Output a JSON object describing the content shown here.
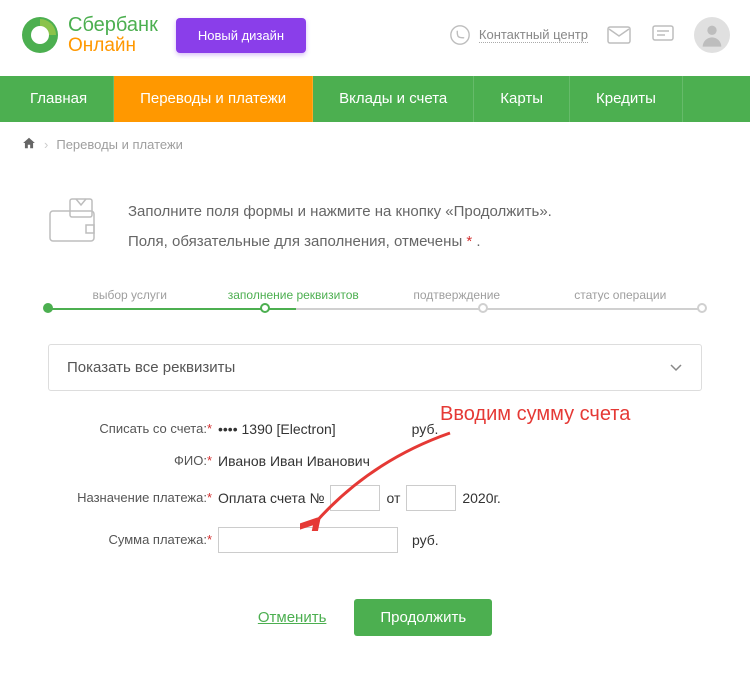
{
  "logo": {
    "line1": "Сбербанк",
    "line2": "Онлайн"
  },
  "header": {
    "new_design": "Новый дизайн",
    "contact_center": "Контактный центр"
  },
  "nav": [
    "Главная",
    "Переводы и платежи",
    "Вклады и счета",
    "Карты",
    "Кредиты"
  ],
  "breadcrumb": {
    "item": "Переводы и платежи"
  },
  "info": {
    "line1": "Заполните поля формы и нажмите на кнопку «Продолжить».",
    "line2_a": "Поля, обязательные для заполнения, отмечены ",
    "line2_b": " ."
  },
  "steps": [
    "выбор услуги",
    "заполнение реквизитов",
    "подтверждение",
    "статус операции"
  ],
  "expand": "Показать все реквизиты",
  "form": {
    "account_label": "Списать со счета:",
    "account_value": "•••• 1390  [Electron]",
    "account_currency": "руб.",
    "fio_label": "ФИО:",
    "fio_value": "Иванов Иван Иванович",
    "purpose_label": "Назначение платежа:",
    "purpose_prefix": "Оплата счета №",
    "purpose_mid": "от",
    "purpose_year": "2020г.",
    "amount_label": "Сумма платежа:",
    "amount_currency": "руб."
  },
  "annotation": "Вводим сумму счета",
  "actions": {
    "cancel": "Отменить",
    "continue": "Продолжить"
  },
  "star": "*"
}
